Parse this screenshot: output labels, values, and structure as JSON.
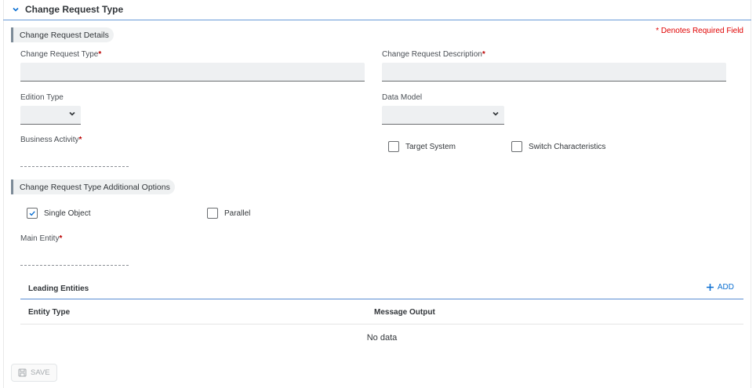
{
  "header": {
    "title": "Change Request Type"
  },
  "required_note": "* Denotes Required Field",
  "sections": {
    "details": "Change Request Details",
    "additional": "Change Request Type Additional Options"
  },
  "fields": {
    "cr_type": {
      "label": "Change Request Type",
      "required": "*",
      "value": ""
    },
    "cr_description": {
      "label": "Change Request Description",
      "required": "*",
      "value": ""
    },
    "edition_type": {
      "label": "Edition Type",
      "value": ""
    },
    "data_model": {
      "label": "Data Model",
      "value": ""
    },
    "business_activity": {
      "label": "Business Activity",
      "required": "*"
    },
    "main_entity": {
      "label": "Main Entity",
      "required": "*"
    }
  },
  "checkboxes": {
    "target_system": {
      "label": "Target System",
      "checked": false
    },
    "switch_characteristics": {
      "label": "Switch Characteristics",
      "checked": false
    },
    "single_object": {
      "label": "Single Object",
      "checked": true
    },
    "parallel": {
      "label": "Parallel",
      "checked": false
    }
  },
  "table": {
    "title": "Leading Entities",
    "add_label": "ADD",
    "columns": [
      "Entity Type",
      "Message Output"
    ],
    "empty_text": "No data"
  },
  "footer": {
    "save_label": "SAVE"
  },
  "colors": {
    "accent": "#0a6ed1",
    "required": "#bb0000",
    "header_line": "#6a9bd8"
  }
}
